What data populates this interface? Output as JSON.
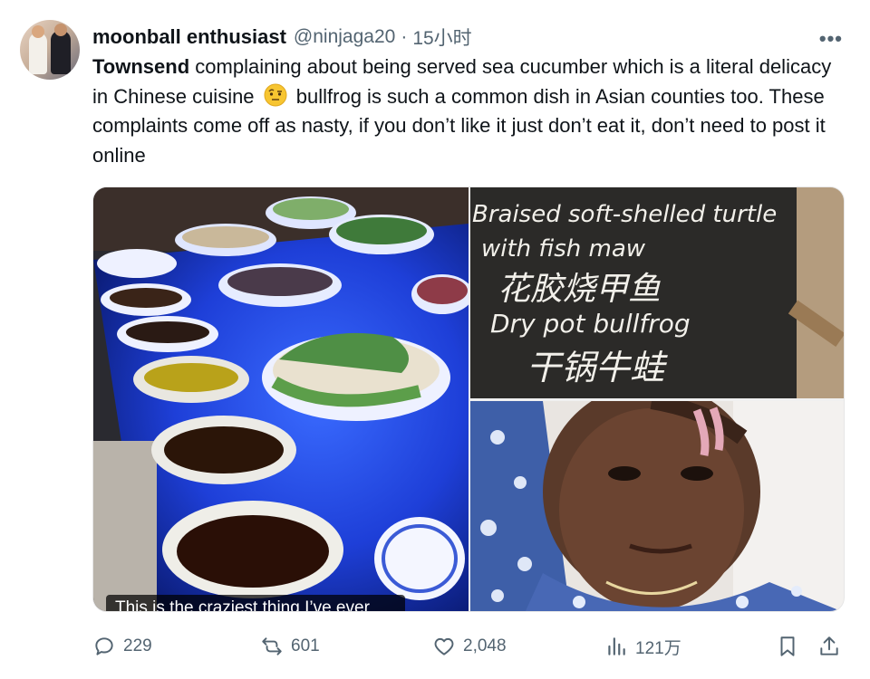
{
  "author": {
    "display_name": "moonball enthusiast",
    "handle": "@ninjaga20",
    "separator": "·",
    "time": "15小时"
  },
  "more_label": "•••",
  "tweet": {
    "lead": "Townsend",
    "text_part1": " complaining about being served sea cucumber which is a literal delicacy in Chinese cuisine",
    "emoji": "face-with-raised-eyebrow",
    "text_part2": " bullfrog is such a common dish in Asian counties too. These complaints come off as nasty, if you don’t like it just don’t eat it, don’t need to post it online"
  },
  "media": {
    "left_caption": "This is the craziest thing I’ve ever",
    "sign_lines": [
      "Braised soft-shelled turtle",
      "with fish maw",
      "花胶烧甲鱼",
      "Dry pot bullfrog",
      "干锅牛蛙"
    ]
  },
  "actions": {
    "reply_count": "229",
    "repost_count": "601",
    "like_count": "2,048",
    "views_count": "121万"
  },
  "colors": {
    "text": "#0f1419",
    "secondary": "#536471",
    "blue_glow": "#1e54ff"
  }
}
